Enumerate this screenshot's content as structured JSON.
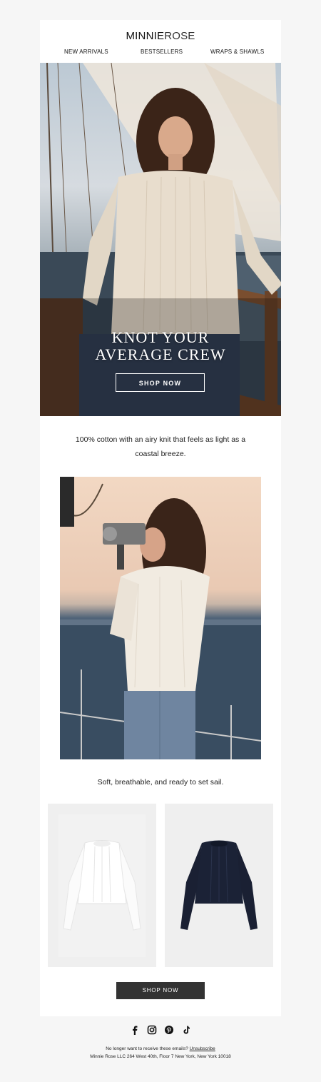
{
  "brand": {
    "name_bold": "MINNIE",
    "name_light": "ROSE"
  },
  "nav": [
    {
      "label": "NEW ARRIVALS"
    },
    {
      "label": "BESTSELLERS"
    },
    {
      "label": "WRAPS & SHAWLS"
    }
  ],
  "hero": {
    "headline_line1": "KNOT YOUR",
    "headline_line2": "AVERAGE CREW",
    "cta_label": "SHOP NOW"
  },
  "body": {
    "copy1": "100% cotton with an airy knit that feels as light as a coastal breeze.",
    "copy2": "Soft, breathable, and ready to set sail."
  },
  "products": [
    {
      "color": "#f7f7f5",
      "alt": "white-sweater"
    },
    {
      "color": "#1b2236",
      "alt": "navy-sweater"
    }
  ],
  "cta_bottom": {
    "label": "SHOP NOW"
  },
  "social": [
    "facebook-icon",
    "instagram-icon",
    "pinterest-icon",
    "tiktok-icon"
  ],
  "footer": {
    "unsubscribe_prefix": "No longer want to receive these emails?",
    "unsubscribe_link": "Unsubscribe",
    "address": "Minnie Rose LLC 264 West 40th, Floor 7 New York, New York 10018"
  }
}
